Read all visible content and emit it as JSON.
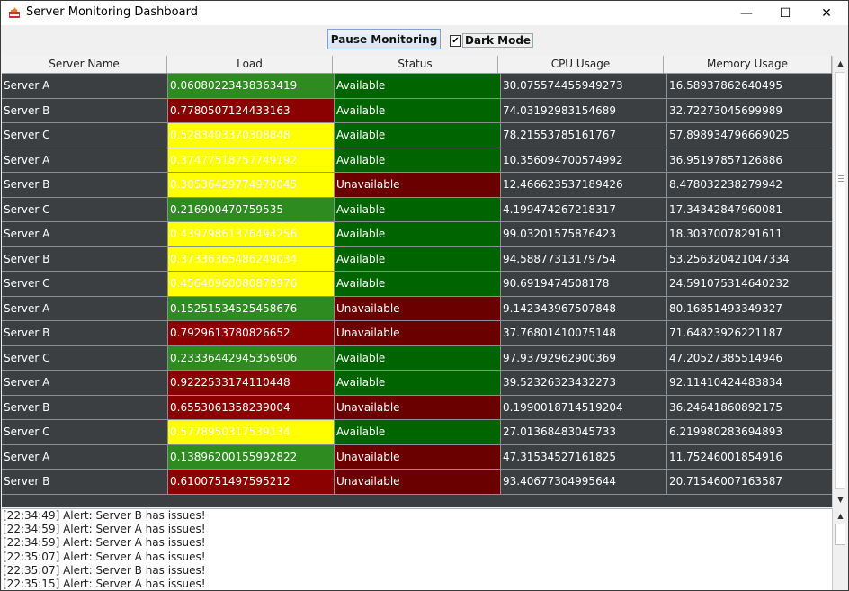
{
  "window": {
    "title": "Server Monitoring Dashboard",
    "minimize": "—",
    "maximize": "☐",
    "close": "✕"
  },
  "toolbar": {
    "pause_label": "Pause Monitoring",
    "dark_mode_label": "Dark Mode",
    "dark_mode_checked": true,
    "checkmark": "✔"
  },
  "colors": {
    "green": "#2e8b1f",
    "dark_green": "#006400",
    "red": "#8b0000",
    "dark_red": "#6b0000",
    "yellow": "#ffff00",
    "gray": "#3c3f41"
  },
  "table": {
    "headers": [
      "Server Name",
      "Load",
      "Status",
      "CPU Usage",
      "Memory Usage"
    ],
    "rows": [
      {
        "name": "Server A",
        "load": "0.06080223438363419",
        "load_color": "green",
        "status": "Available",
        "cpu": "30.075574455949273",
        "mem": "16.58937862640495"
      },
      {
        "name": "Server B",
        "load": "0.7780507124433163",
        "load_color": "red",
        "status": "Available",
        "cpu": "74.03192983154689",
        "mem": "32.72273045699989"
      },
      {
        "name": "Server C",
        "load": "0.5283403370308848",
        "load_color": "yellow",
        "status": "Available",
        "cpu": "78.21553785161767",
        "mem": "57.898934796669025"
      },
      {
        "name": "Server A",
        "load": "0.37477518757749192",
        "load_color": "yellow",
        "status": "Available",
        "cpu": "10.356094700574992",
        "mem": "36.95197857126886"
      },
      {
        "name": "Server B",
        "load": "0.30536429774970045",
        "load_color": "yellow",
        "status": "Unavailable",
        "cpu": "12.466623537189426",
        "mem": "8.478032238279942"
      },
      {
        "name": "Server C",
        "load": "0.216900470759535",
        "load_color": "green",
        "status": "Available",
        "cpu": "4.199474267218317",
        "mem": "17.34342847960081"
      },
      {
        "name": "Server A",
        "load": "0.43979861376494256",
        "load_color": "yellow",
        "status": "Available",
        "cpu": "99.03201575876423",
        "mem": "18.30370078291611"
      },
      {
        "name": "Server B",
        "load": "0.37336365486249034",
        "load_color": "yellow",
        "status": "Available",
        "cpu": "94.58877313179754",
        "mem": "53.256320421047334"
      },
      {
        "name": "Server C",
        "load": "0.45640960080878976",
        "load_color": "yellow",
        "status": "Available",
        "cpu": "90.6919474508178",
        "mem": "24.591075314640232"
      },
      {
        "name": "Server A",
        "load": "0.15251534525458676",
        "load_color": "green",
        "status": "Unavailable",
        "cpu": "9.142343967507848",
        "mem": "80.16851493349327"
      },
      {
        "name": "Server B",
        "load": "0.7929613780826652",
        "load_color": "red",
        "status": "Unavailable",
        "cpu": "37.76801410075148",
        "mem": "71.64823926221187"
      },
      {
        "name": "Server C",
        "load": "0.23336442945356906",
        "load_color": "green",
        "status": "Available",
        "cpu": "97.93792962900369",
        "mem": "47.20527385514946"
      },
      {
        "name": "Server A",
        "load": "0.9222533174110448",
        "load_color": "red",
        "status": "Available",
        "cpu": "39.52326323432273",
        "mem": "92.11410424483834"
      },
      {
        "name": "Server B",
        "load": "0.6553061358239004",
        "load_color": "red",
        "status": "Unavailable",
        "cpu": "0.1990018714519204",
        "mem": "36.24641860892175"
      },
      {
        "name": "Server C",
        "load": "0.5778950317539134",
        "load_color": "yellow",
        "status": "Available",
        "cpu": "27.01368483045733",
        "mem": "6.219980283694893"
      },
      {
        "name": "Server A",
        "load": "0.13896200155992822",
        "load_color": "green",
        "status": "Unavailable",
        "cpu": "47.31534527161825",
        "mem": "11.75246001854916"
      },
      {
        "name": "Server B",
        "load": "0.6100751497595212",
        "load_color": "red",
        "status": "Unavailable",
        "cpu": "93.40677304995644",
        "mem": "20.71546007163587"
      }
    ]
  },
  "log": [
    "[22:34:49] Alert: Server B has issues!",
    "[22:34:59] Alert: Server A has issues!",
    "[22:34:59] Alert: Server A has issues!",
    "[22:35:07] Alert: Server A has issues!",
    "[22:35:07] Alert: Server B has issues!",
    "[22:35:15] Alert: Server A has issues!"
  ]
}
